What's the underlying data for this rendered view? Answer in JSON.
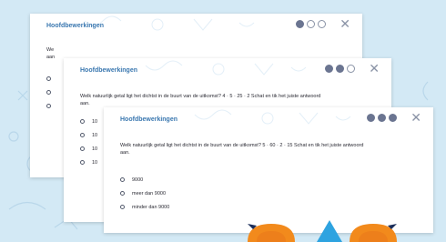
{
  "colors": {
    "background": "#d3e9f5",
    "accent": "#3b78b0",
    "dot_active": "#6b7591",
    "mascot_orange": "#f28a1c"
  },
  "icons": {
    "close": "close-icon",
    "radio": "radio-icon"
  },
  "card1": {
    "title": "Hoofdbewerkingen",
    "question": "We",
    "question_line2": "aan",
    "progress": 1,
    "options": [
      "",
      "",
      ""
    ]
  },
  "card2": {
    "title": "Hoofdbewerkingen",
    "question": "Welk natuurlijk getal ligt het dichtst in de buurt van de uitkomst? 4 · 5 · 25 · 2 Schat en tik het juiste antwoord",
    "question_line2": "aan.",
    "progress": 2,
    "options": [
      "10",
      "10",
      "10",
      "10"
    ]
  },
  "card3": {
    "title": "Hoofdbewerkingen",
    "question": "Welk natuurlijk getal ligt het dichtst in de buurt van de uitkomst? 5 · 60 · 2 · 15 Schat en tik het juiste antwoord",
    "question_line2": "aan.",
    "progress": 3,
    "options": [
      "9000",
      "meer dan 9000",
      "minder dan 9000"
    ]
  },
  "close_symbol": "✕"
}
